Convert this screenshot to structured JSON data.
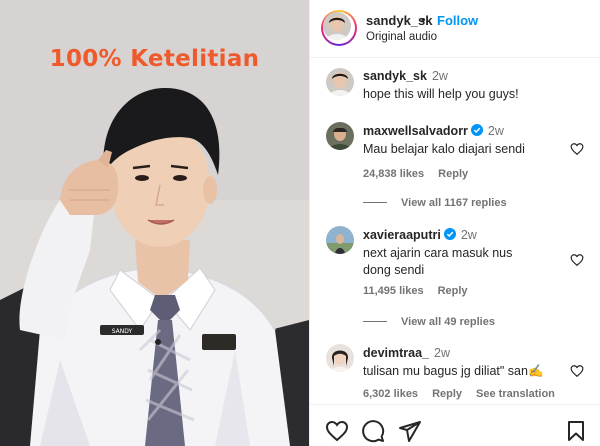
{
  "video": {
    "overlay_text": "100% Ketelitian",
    "name_tag": "SANDY"
  },
  "header": {
    "username": "sandyk_sk",
    "separator": "•",
    "follow_label": "Follow",
    "subtitle": "Original audio"
  },
  "caption": {
    "username": "sandyk_sk",
    "time": "2w",
    "text": "hope this will help you guys!"
  },
  "comments": [
    {
      "username": "maxwellsalvadorr",
      "verified": true,
      "time": "2w",
      "text": "Mau belajar kalo diajari sendi",
      "likes": "24,838 likes",
      "reply": "Reply",
      "view_replies": "View all 1167 replies"
    },
    {
      "username": "xavieraaputri",
      "verified": true,
      "time": "2w",
      "text": "next ajarin cara masuk nus dong sendi",
      "likes": "11,495 likes",
      "reply": "Reply",
      "view_replies": "View all 49 replies"
    },
    {
      "username": "devimtraa_",
      "verified": false,
      "time": "2w",
      "text": "tulisan mu bagus jg diliat\" san✍️",
      "likes": "6,302 likes",
      "reply": "Reply",
      "see_translation": "See translation"
    }
  ],
  "colors": {
    "overlay_text": "#ef5a2c",
    "follow_blue": "#0095f6",
    "verified_blue": "#0095f6",
    "secondary_text": "#737373"
  },
  "icons": [
    "heart-icon",
    "comment-icon",
    "share-icon",
    "bookmark-icon",
    "verified-badge-icon"
  ]
}
